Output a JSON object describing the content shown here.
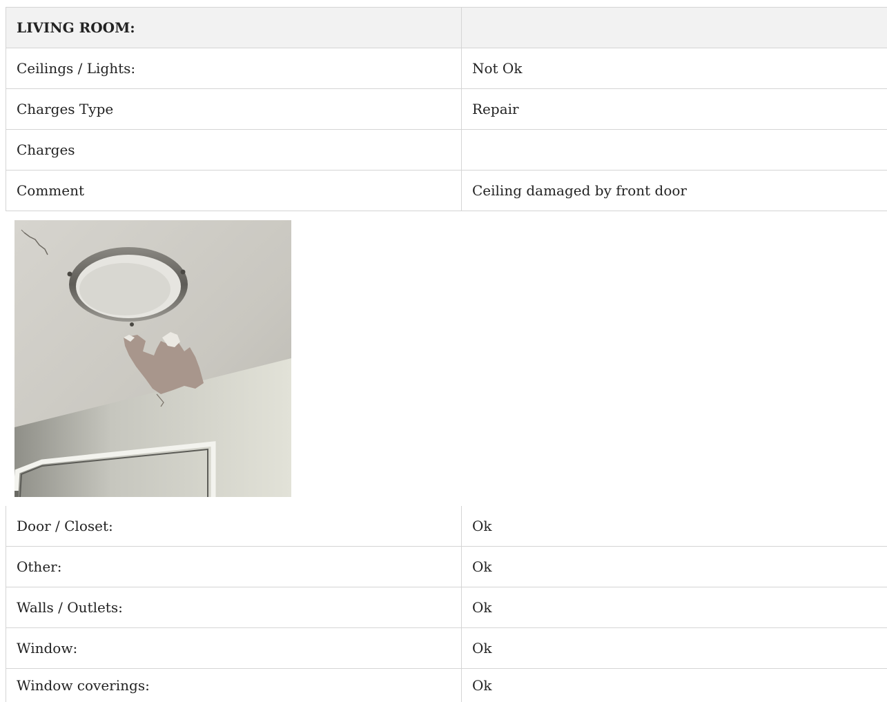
{
  "section": {
    "title": "LIVING ROOM:",
    "header_value": ""
  },
  "top_rows": [
    {
      "label": "Ceilings / Lights:",
      "value": "Not Ok"
    },
    {
      "label": "Charges Type",
      "value": "Repair"
    },
    {
      "label": "Charges",
      "value": ""
    },
    {
      "label": "Comment",
      "value": "Ceiling damaged by front door"
    }
  ],
  "bottom_rows": [
    {
      "label": "Door / Closet:",
      "value": "Ok"
    },
    {
      "label": "Other:",
      "value": "Ok"
    },
    {
      "label": "Walls / Outlets:",
      "value": "Ok"
    },
    {
      "label": "Window:",
      "value": "Ok"
    },
    {
      "label": "Window coverings:",
      "value": "Ok"
    }
  ]
}
